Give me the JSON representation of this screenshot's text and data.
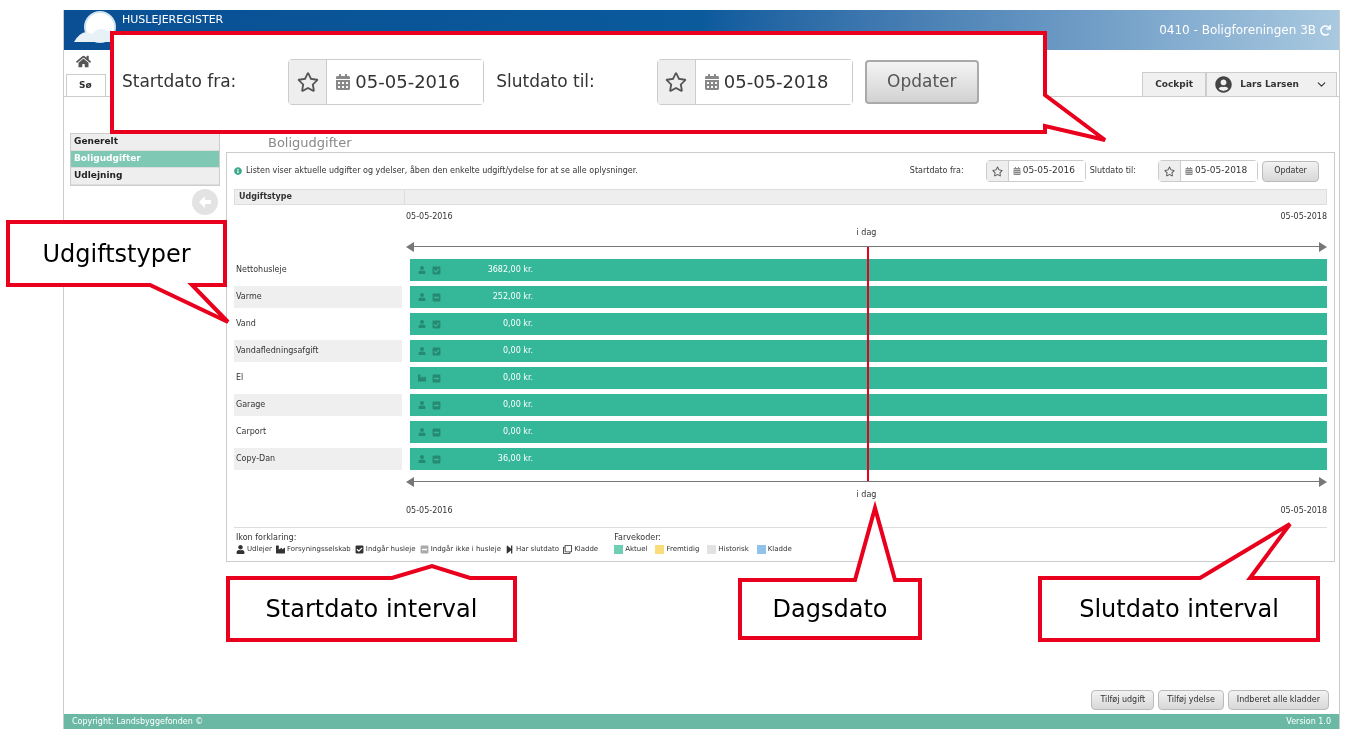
{
  "header": {
    "app_name": "HUSLEJEREGISTER",
    "organization": "0410 - Boligforeningen 3B"
  },
  "tabs_left": [
    {
      "label": "Sø",
      "selected": true
    }
  ],
  "tabs_right": [
    {
      "label": "Cockpit",
      "kind": "plain"
    },
    {
      "label": "Lars Larsen",
      "kind": "user"
    }
  ],
  "sidebar": {
    "items": [
      {
        "label": "Generelt",
        "selected": false
      },
      {
        "label": "Boligudgifter",
        "selected": true
      },
      {
        "label": "Udlejning",
        "selected": false
      }
    ]
  },
  "page_title": "Boligudgifter",
  "info": "Listen viser aktuelle udgifter og ydelser, åben den enkelte udgift/ydelse for at se alle oplysninger.",
  "filters": {
    "start_label": "Startdato fra:",
    "start_value": "05-05-2016",
    "end_label": "Slutdato til:",
    "end_value": "05-05-2018",
    "button": "Opdater"
  },
  "column_header": "Udgiftstype",
  "timeline": {
    "start_top": "05-05-2016",
    "end_top": "05-05-2018",
    "today_top": "i dag",
    "today_bottom": "i dag",
    "start_bottom": "05-05-2016",
    "end_bottom": "05-05-2018"
  },
  "rows": [
    {
      "name": "Nettohusleje",
      "kind": "udlejer",
      "included": true,
      "amount": "3682,00 kr."
    },
    {
      "name": "Varme",
      "kind": "udlejer",
      "included": false,
      "amount": "252,00 kr."
    },
    {
      "name": "Vand",
      "kind": "udlejer",
      "included": true,
      "amount": "0,00 kr."
    },
    {
      "name": "Vandafledningsafgift",
      "kind": "udlejer",
      "included": true,
      "amount": "0,00 kr."
    },
    {
      "name": "El",
      "kind": "forsyning",
      "included": false,
      "amount": "0,00 kr."
    },
    {
      "name": "Garage",
      "kind": "udlejer",
      "included": false,
      "amount": "0,00 kr."
    },
    {
      "name": "Carport",
      "kind": "udlejer",
      "included": false,
      "amount": "0,00 kr."
    },
    {
      "name": "Copy-Dan",
      "kind": "udlejer",
      "included": false,
      "amount": "36,00 kr."
    }
  ],
  "legend": {
    "icons_title": "Ikon forklaring:",
    "icons": [
      {
        "kind": "udlejer",
        "label": "Udlejer"
      },
      {
        "kind": "forsyning",
        "label": "Forsyningsselskab"
      },
      {
        "kind": "included",
        "label": "Indgår husleje"
      },
      {
        "kind": "excluded",
        "label": "Indgår ikke i husleje"
      },
      {
        "kind": "end",
        "label": "Har slutdato"
      },
      {
        "kind": "draft",
        "label": "Kladde"
      }
    ],
    "colors_title": "Farvekoder:",
    "colors": [
      {
        "label": "Aktuel",
        "color": "#6fcfb5"
      },
      {
        "label": "Fremtidig",
        "color": "#f9dd7a"
      },
      {
        "label": "Historisk",
        "color": "#e2e2e2"
      },
      {
        "label": "Kladde",
        "color": "#8fc3ea"
      }
    ]
  },
  "buttons": [
    "Tilføj udgift",
    "Tilføj ydelse",
    "Indberet alle kladder"
  ],
  "footer": {
    "copyright": "Copyright: Landsbyggefonden ©",
    "version": "Version 1.0"
  },
  "callout_zoom": {
    "start_label": "Startdato fra:",
    "start_value": "05-05-2016",
    "end_label": "Slutdato til:",
    "end_value": "05-05-2018",
    "button": "Opdater"
  },
  "callouts": [
    {
      "text": "Udgiftstyper"
    },
    {
      "text": "Startdato interval"
    },
    {
      "text": "Dagsdato"
    },
    {
      "text": "Slutdato interval"
    }
  ]
}
